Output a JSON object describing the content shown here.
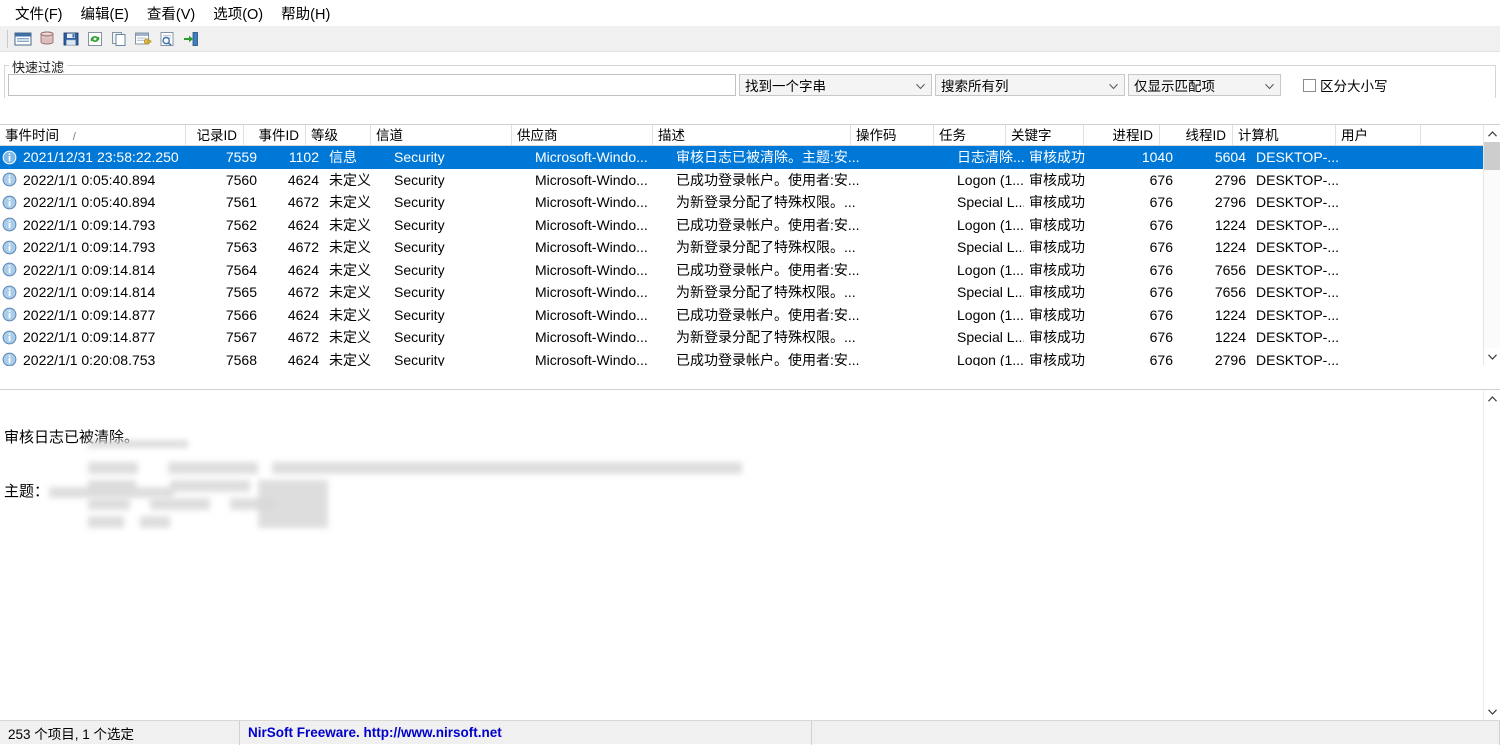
{
  "menu": {
    "items": [
      {
        "label": "文件(F)",
        "name": "menu-file"
      },
      {
        "label": "编辑(E)",
        "name": "menu-edit"
      },
      {
        "label": "查看(V)",
        "name": "menu-view"
      },
      {
        "label": "选项(O)",
        "name": "menu-options"
      },
      {
        "label": "帮助(H)",
        "name": "menu-help"
      }
    ]
  },
  "toolbar": {
    "buttons": [
      {
        "name": "select-event-sources-button",
        "icon": "window-icon"
      },
      {
        "name": "load-events-button",
        "icon": "database-icon"
      },
      {
        "name": "save-selected-items-button",
        "icon": "save-icon"
      },
      {
        "name": "refresh-button",
        "icon": "refresh-icon"
      },
      {
        "name": "copy-button",
        "icon": "copy-icon"
      },
      {
        "name": "properties-button",
        "icon": "properties-icon"
      },
      {
        "name": "html-report-button",
        "icon": "report-icon"
      },
      {
        "name": "exit-button",
        "icon": "exit-icon"
      }
    ]
  },
  "quick_filter": {
    "group_title": "快速过滤",
    "input_value": "",
    "input_placeholder": "",
    "match_mode": "找到一个字串",
    "column_scope": "搜索所有列",
    "display_mode": "仅显示匹配项",
    "case_sensitive_label": "区分大小写",
    "case_sensitive_checked": false
  },
  "table": {
    "columns": [
      {
        "key": "time",
        "label": "事件时间",
        "sorted": true,
        "sort_indicator": "/"
      },
      {
        "key": "recid",
        "label": "记录ID"
      },
      {
        "key": "evtid",
        "label": "事件ID"
      },
      {
        "key": "level",
        "label": "等级"
      },
      {
        "key": "chan",
        "label": "信道"
      },
      {
        "key": "prov",
        "label": "供应商"
      },
      {
        "key": "desc",
        "label": "描述"
      },
      {
        "key": "op",
        "label": "操作码"
      },
      {
        "key": "task",
        "label": "任务"
      },
      {
        "key": "key",
        "label": "关键字"
      },
      {
        "key": "pid",
        "label": "进程ID"
      },
      {
        "key": "tid",
        "label": "线程ID"
      },
      {
        "key": "comp",
        "label": "计算机"
      },
      {
        "key": "user",
        "label": "用户"
      }
    ],
    "rows": [
      {
        "selected": true,
        "icon": "info-icon",
        "time": "2021/12/31 23:58:22.250",
        "recid": "7559",
        "evtid": "1102",
        "level": "信息",
        "chan": "Security",
        "prov": "Microsoft-Windo...",
        "desc": "审核日志已被清除。主题:安...",
        "op": "",
        "task": "日志清除...",
        "key": "审核成功",
        "pid": "1040",
        "tid": "5604",
        "comp": "DESKTOP-...",
        "user": ""
      },
      {
        "selected": false,
        "icon": "info-icon",
        "time": "2022/1/1 0:05:40.894",
        "recid": "7560",
        "evtid": "4624",
        "level": "未定义",
        "chan": "Security",
        "prov": "Microsoft-Windo...",
        "desc": "已成功登录帐户。使用者:安...",
        "op": "",
        "task": "Logon (1...",
        "key": "审核成功",
        "pid": "676",
        "tid": "2796",
        "comp": "DESKTOP-...",
        "user": ""
      },
      {
        "selected": false,
        "icon": "info-icon",
        "time": "2022/1/1 0:05:40.894",
        "recid": "7561",
        "evtid": "4672",
        "level": "未定义",
        "chan": "Security",
        "prov": "Microsoft-Windo...",
        "desc": "为新登录分配了特殊权限。...",
        "op": "",
        "task": "Special L...",
        "key": "审核成功",
        "pid": "676",
        "tid": "2796",
        "comp": "DESKTOP-...",
        "user": ""
      },
      {
        "selected": false,
        "icon": "info-icon",
        "time": "2022/1/1 0:09:14.793",
        "recid": "7562",
        "evtid": "4624",
        "level": "未定义",
        "chan": "Security",
        "prov": "Microsoft-Windo...",
        "desc": "已成功登录帐户。使用者:安...",
        "op": "",
        "task": "Logon (1...",
        "key": "审核成功",
        "pid": "676",
        "tid": "1224",
        "comp": "DESKTOP-...",
        "user": ""
      },
      {
        "selected": false,
        "icon": "info-icon",
        "time": "2022/1/1 0:09:14.793",
        "recid": "7563",
        "evtid": "4672",
        "level": "未定义",
        "chan": "Security",
        "prov": "Microsoft-Windo...",
        "desc": "为新登录分配了特殊权限。...",
        "op": "",
        "task": "Special L...",
        "key": "审核成功",
        "pid": "676",
        "tid": "1224",
        "comp": "DESKTOP-...",
        "user": ""
      },
      {
        "selected": false,
        "icon": "info-icon",
        "time": "2022/1/1 0:09:14.814",
        "recid": "7564",
        "evtid": "4624",
        "level": "未定义",
        "chan": "Security",
        "prov": "Microsoft-Windo...",
        "desc": "已成功登录帐户。使用者:安...",
        "op": "",
        "task": "Logon (1...",
        "key": "审核成功",
        "pid": "676",
        "tid": "7656",
        "comp": "DESKTOP-...",
        "user": ""
      },
      {
        "selected": false,
        "icon": "info-icon",
        "time": "2022/1/1 0:09:14.814",
        "recid": "7565",
        "evtid": "4672",
        "level": "未定义",
        "chan": "Security",
        "prov": "Microsoft-Windo...",
        "desc": "为新登录分配了特殊权限。...",
        "op": "",
        "task": "Special L...",
        "key": "审核成功",
        "pid": "676",
        "tid": "7656",
        "comp": "DESKTOP-...",
        "user": ""
      },
      {
        "selected": false,
        "icon": "info-icon",
        "time": "2022/1/1 0:09:14.877",
        "recid": "7566",
        "evtid": "4624",
        "level": "未定义",
        "chan": "Security",
        "prov": "Microsoft-Windo...",
        "desc": "已成功登录帐户。使用者:安...",
        "op": "",
        "task": "Logon (1...",
        "key": "审核成功",
        "pid": "676",
        "tid": "1224",
        "comp": "DESKTOP-...",
        "user": ""
      },
      {
        "selected": false,
        "icon": "info-icon",
        "time": "2022/1/1 0:09:14.877",
        "recid": "7567",
        "evtid": "4672",
        "level": "未定义",
        "chan": "Security",
        "prov": "Microsoft-Windo...",
        "desc": "为新登录分配了特殊权限。...",
        "op": "",
        "task": "Special L...",
        "key": "审核成功",
        "pid": "676",
        "tid": "1224",
        "comp": "DESKTOP-...",
        "user": ""
      },
      {
        "selected": false,
        "icon": "info-icon",
        "time": "2022/1/1 0:20:08.753",
        "recid": "7568",
        "evtid": "4624",
        "level": "未定义",
        "chan": "Security",
        "prov": "Microsoft-Windo...",
        "desc": "已成功登录帐户。使用者:安...",
        "op": "",
        "task": "Logon (1...",
        "key": "审核成功",
        "pid": "676",
        "tid": "2796",
        "comp": "DESKTOP-...",
        "user": ""
      }
    ]
  },
  "detail": {
    "line1": "审核日志已被清除。",
    "line2_label": "主题：",
    "redacted_note": "内容已模糊处理"
  },
  "status": {
    "items_text": "253 个项目, 1 个选定",
    "link_text": "NirSoft Freeware.  http://www.nirsoft.net"
  },
  "colors": {
    "selection": "#0078d7",
    "link": "#0000cc",
    "toolbar_bg": "#f0f0f0",
    "scrollbar_thumb": "#cdcdcd"
  }
}
